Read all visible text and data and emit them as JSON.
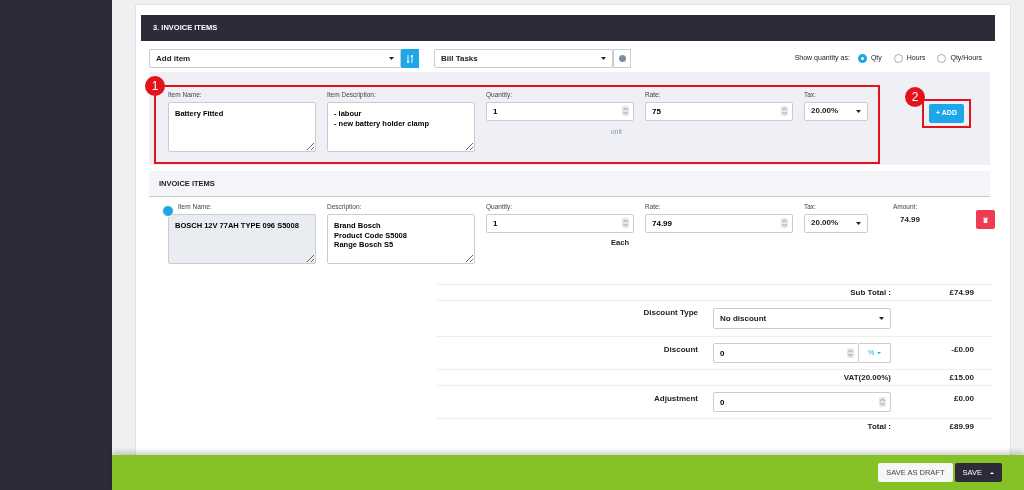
{
  "section_title": "3. INVOICE ITEMS",
  "toolbar": {
    "add_item": {
      "value": "Add item"
    },
    "bill_tasks": {
      "value": "Bill Tasks"
    },
    "quantity_label": "Show quantity as:",
    "quantity_modes": [
      {
        "label": "Qty",
        "selected": true
      },
      {
        "label": "Hours",
        "selected": false
      },
      {
        "label": "Qty/Hours",
        "selected": false
      }
    ]
  },
  "new_item": {
    "badge": "1",
    "item_name": {
      "label": "Item Name:",
      "value": "Battery Fitted"
    },
    "description": {
      "label": "Item Description:",
      "value": "- labour\n- new battery holder clamp"
    },
    "quantity": {
      "label": "Quantity:",
      "value": "1",
      "unit": "unit"
    },
    "rate": {
      "label": "Rate:",
      "value": "75"
    },
    "tax": {
      "label": "Tax:",
      "value": "20.00%"
    },
    "add_badge": "2",
    "add_button": "+ ADD"
  },
  "invoice_items": {
    "title": "INVOICE ITEMS",
    "rows": [
      {
        "item_name": {
          "label": "Item Name:",
          "value": "BOSCH 12V 77AH TYPE 096 S5008"
        },
        "description": {
          "label": "Description:",
          "value": "Brand Bosch\nProduct Code S5008\nRange Bosch S5"
        },
        "quantity": {
          "label": "Quantity:",
          "value": "1",
          "unit": "Each"
        },
        "rate": {
          "label": "Rate:",
          "value": "74.99"
        },
        "tax": {
          "label": "Tax:",
          "value": "20.00%"
        },
        "amount": {
          "label": "Amount:",
          "value": "74.99"
        }
      }
    ]
  },
  "totals": [
    {
      "kind": "text",
      "label": "Sub Total :",
      "amount": "£74.99"
    },
    {
      "kind": "select",
      "label": "Discount Type",
      "value": "No discount"
    },
    {
      "kind": "input_unit",
      "label": "Discount",
      "value": "0",
      "unit": "%",
      "amount": "-£0.00"
    },
    {
      "kind": "text",
      "label": "VAT(20.00%)",
      "amount": "£15.00"
    },
    {
      "kind": "input",
      "label": "Adjustment",
      "value": "0",
      "amount": "£0.00"
    },
    {
      "kind": "text",
      "label": "Total :",
      "amount": "£89.99"
    }
  ],
  "footer": {
    "buttons": [
      {
        "label": "SAVE AS DRAFT",
        "kind": "secondary"
      },
      {
        "label": "SAVE",
        "kind": "primary"
      }
    ]
  }
}
